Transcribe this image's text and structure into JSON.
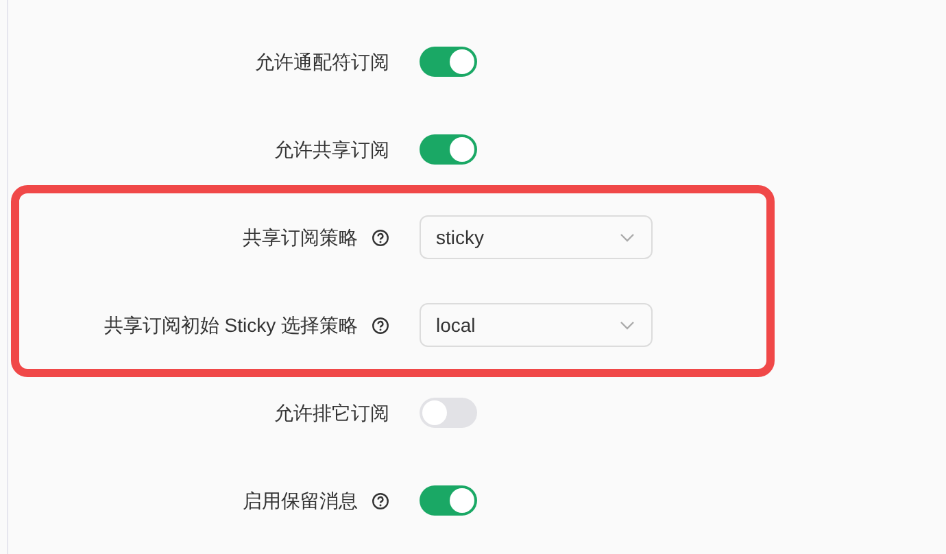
{
  "settings": [
    {
      "label": "允许通配符订阅",
      "kind": "toggle",
      "on": true,
      "help": false,
      "highlighted": false
    },
    {
      "label": "允许共享订阅",
      "kind": "toggle",
      "on": true,
      "help": false,
      "highlighted": false
    },
    {
      "label": "共享订阅策略",
      "kind": "select",
      "value": "sticky",
      "help": true,
      "highlighted": true
    },
    {
      "label": "共享订阅初始 Sticky 选择策略",
      "kind": "select",
      "value": "local",
      "help": true,
      "highlighted": true
    },
    {
      "label": "允许排它订阅",
      "kind": "toggle",
      "on": false,
      "help": false,
      "highlighted": false
    },
    {
      "label": "启用保留消息",
      "kind": "toggle",
      "on": true,
      "help": true,
      "highlighted": false
    }
  ]
}
